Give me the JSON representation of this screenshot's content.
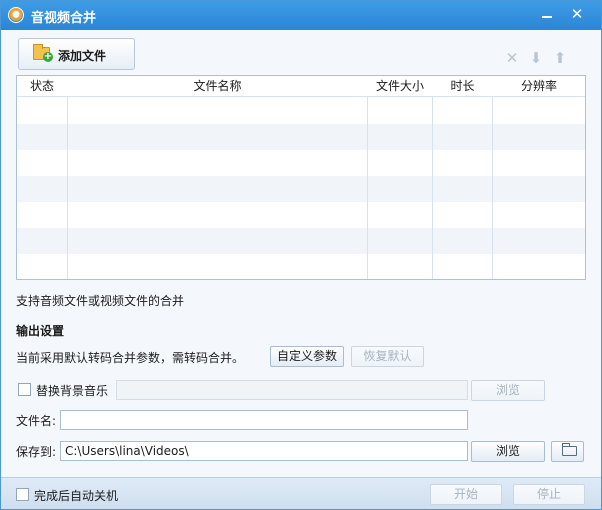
{
  "window": {
    "title": "音视频合并",
    "minimize_glyph": "",
    "close_glyph": "✕"
  },
  "toolbar": {
    "add_file_label": "添加文件",
    "icons": [
      "delete-icon",
      "move-down-icon",
      "move-up-icon"
    ],
    "delete_glyph": "✕",
    "down_glyph": "⬇",
    "up_glyph": "⬆"
  },
  "table": {
    "columns": [
      "状态",
      "文件名称",
      "文件大小",
      "时长",
      "分辨率"
    ],
    "rows": []
  },
  "hint": "支持音频文件或视频文件的合并",
  "output": {
    "section_title": "输出设置",
    "param_text": "当前采用默认转码合并参数，需转码合并。",
    "custom_params_label": "自定义参数",
    "restore_default_label": "恢复默认",
    "replace_bgm_label": "替换背景音乐",
    "replace_bgm_value": "",
    "browse_label": "浏览",
    "filename_label": "文件名:",
    "filename_value": "",
    "save_to_label": "保存到:",
    "save_to_value": "C:\\Users\\lina\\Videos\\"
  },
  "footer": {
    "auto_shutdown_label": "完成后自动关机",
    "start_label": "开始",
    "stop_label": "停止"
  },
  "colors": {
    "titlebar": "#2a86d6",
    "accent": "#4a98d6"
  }
}
